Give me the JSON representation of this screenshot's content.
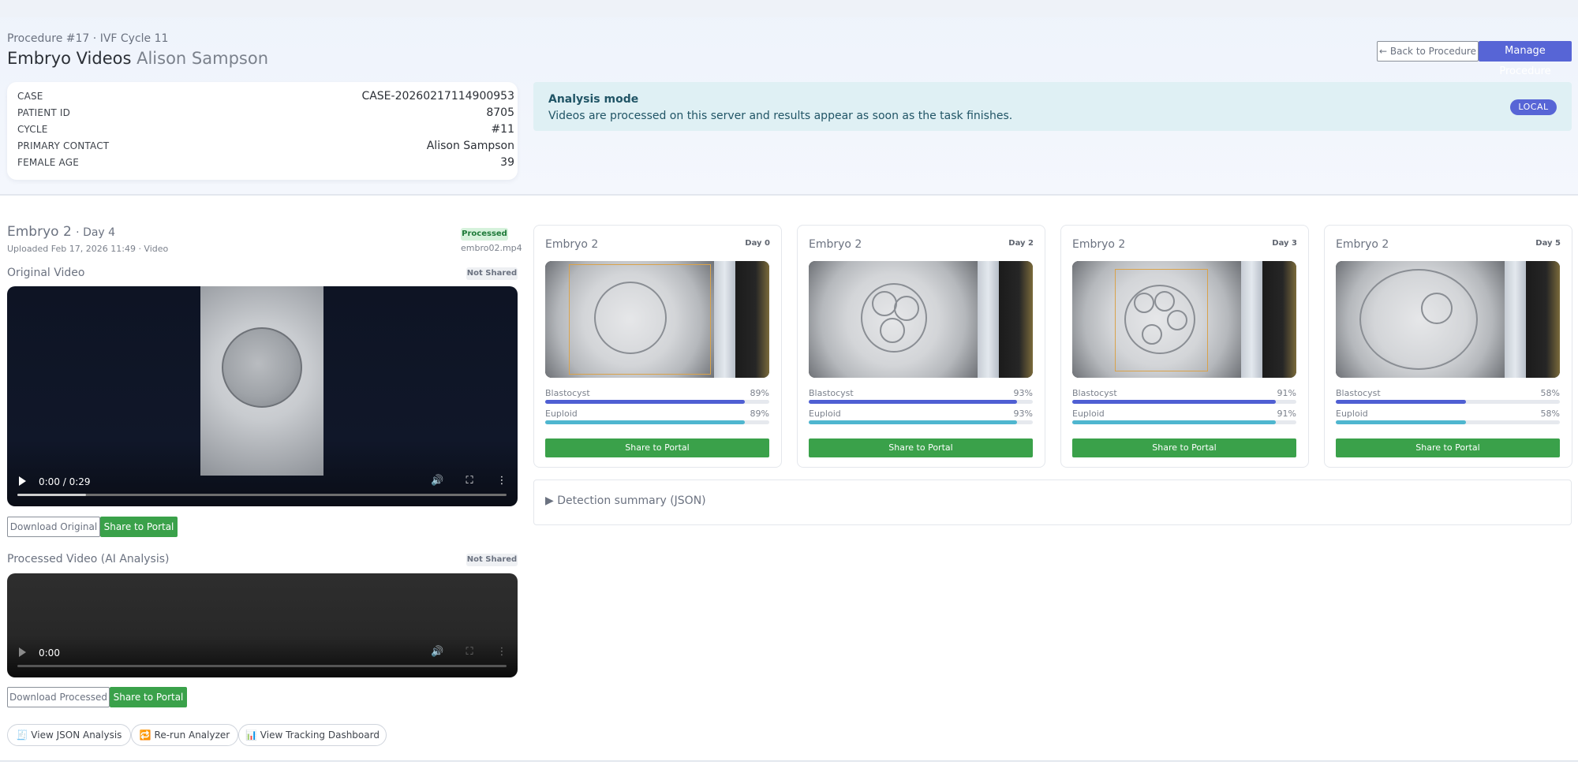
{
  "header": {
    "crumb": "Procedure #17 · IVF Cycle 11",
    "title": "Embryo Videos",
    "patient_name": "Alison Sampson",
    "back_label": "← Back to Procedure",
    "manage_label": "Manage Procedure"
  },
  "case_card": [
    {
      "key": "CASE",
      "value": "CASE-20260217114900953"
    },
    {
      "key": "PATIENT ID",
      "value": "8705"
    },
    {
      "key": "CYCLE",
      "value": "#11"
    },
    {
      "key": "PRIMARY CONTACT",
      "value": "Alison Sampson"
    },
    {
      "key": "FEMALE AGE",
      "value": "39"
    }
  ],
  "analysis": {
    "heading": "Analysis mode",
    "text": "Videos are processed on this server and results appear as soon as the task finishes.",
    "badge": "LOCAL"
  },
  "embryo": {
    "name": "Embryo 2",
    "day": "· Day 4",
    "uploaded": "Uploaded Feb 17, 2026 11:49 · Video",
    "status": "Processed",
    "filename": "embro02.mp4"
  },
  "original_video": {
    "label": "Original Video",
    "share_status": "Not Shared",
    "time": "0:00 / 0:29",
    "progress": 0.14,
    "download_label": "Download Original",
    "share_label": "Share to Portal"
  },
  "processed_video": {
    "label": "Processed Video (AI Analysis)",
    "share_status": "Not Shared",
    "time": "0:00",
    "download_label": "Download Processed",
    "share_label": "Share to Portal"
  },
  "actions": {
    "view_json": "🧾 View JSON Analysis",
    "rerun": "🔁 Re-run Analyzer",
    "tracking": "📊 View Tracking Dashboard"
  },
  "day_cards": [
    {
      "title": "Embryo 2",
      "day": "Day 0",
      "blastocyst_label": "Blastocyst",
      "blastocyst": "89%",
      "blastocyst_frac": 0.89,
      "euploid_label": "Euploid",
      "euploid": "89%",
      "euploid_frac": 0.89,
      "share_label": "Share to Portal"
    },
    {
      "title": "Embryo 2",
      "day": "Day 2",
      "blastocyst_label": "Blastocyst",
      "blastocyst": "93%",
      "blastocyst_frac": 0.93,
      "euploid_label": "Euploid",
      "euploid": "93%",
      "euploid_frac": 0.93,
      "share_label": "Share to Portal"
    },
    {
      "title": "Embryo 2",
      "day": "Day 3",
      "blastocyst_label": "Blastocyst",
      "blastocyst": "91%",
      "blastocyst_frac": 0.91,
      "euploid_label": "Euploid",
      "euploid": "91%",
      "euploid_frac": 0.91,
      "share_label": "Share to Portal"
    },
    {
      "title": "Embryo 2",
      "day": "Day 5",
      "blastocyst_label": "Blastocyst",
      "blastocyst": "58%",
      "blastocyst_frac": 0.58,
      "euploid_label": "Euploid",
      "euploid": "58%",
      "euploid_frac": 0.58,
      "share_label": "Share to Portal"
    }
  ],
  "detection": {
    "label": "▶ Detection summary (JSON)"
  },
  "colors": {
    "primary": "#5765d6",
    "success": "#3aa14a",
    "info_bg": "#dff0f4",
    "blastocyst_bar": "#4f5fd3",
    "euploid_bar": "#4fb6cf"
  }
}
